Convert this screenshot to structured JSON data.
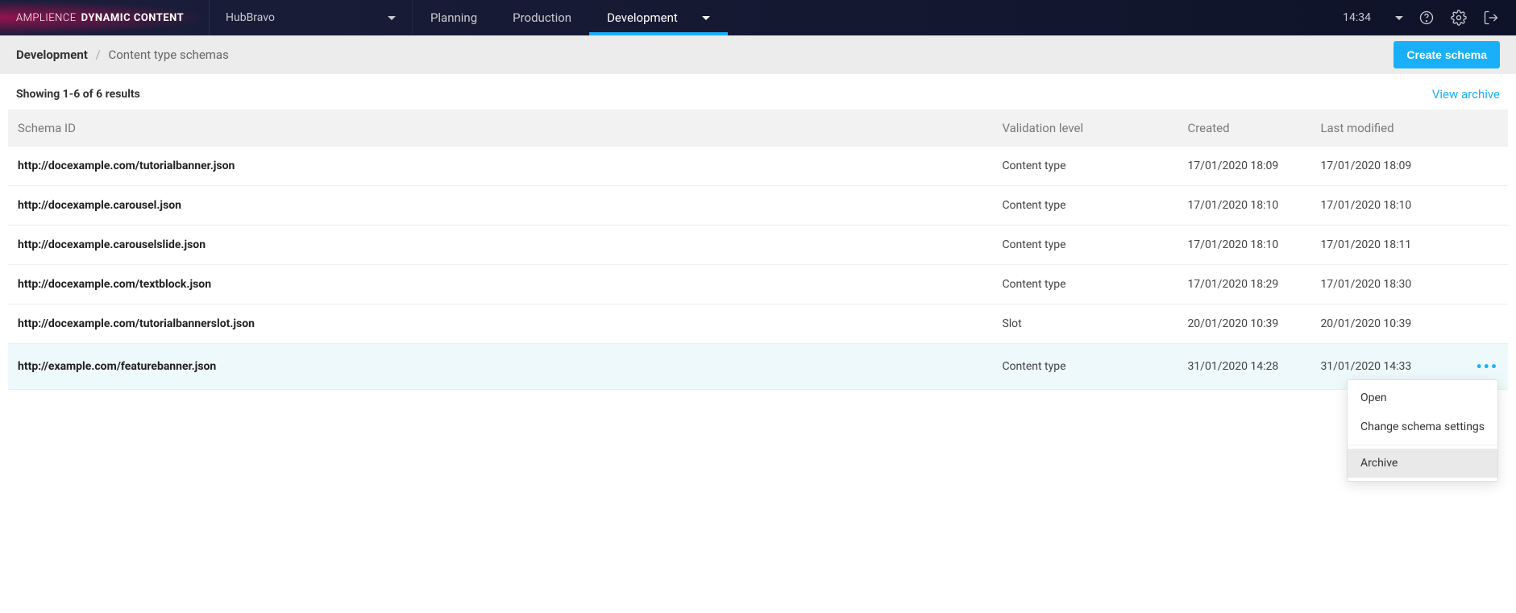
{
  "brand": {
    "light": "AMPLIENCE",
    "bold": "DYNAMIC CONTENT"
  },
  "hub": {
    "name": "HubBravo"
  },
  "nav": {
    "planning": "Planning",
    "production": "Production",
    "development": "Development"
  },
  "topbar": {
    "time": "14:34"
  },
  "breadcrumb": {
    "first": "Development",
    "second": "Content type schemas"
  },
  "actions": {
    "create_schema": "Create schema",
    "view_archive": "View archive"
  },
  "results_text": "Showing 1-6 of 6 results",
  "columns": {
    "schema_id": "Schema ID",
    "validation": "Validation level",
    "created": "Created",
    "modified": "Last modified"
  },
  "rows": [
    {
      "schema_id": "http://docexample.com/tutorialbanner.json",
      "validation": "Content type",
      "created": "17/01/2020 18:09",
      "modified": "17/01/2020 18:09"
    },
    {
      "schema_id": "http://docexample.carousel.json",
      "validation": "Content type",
      "created": "17/01/2020 18:10",
      "modified": "17/01/2020 18:10"
    },
    {
      "schema_id": "http://docexample.carouselslide.json",
      "validation": "Content type",
      "created": "17/01/2020 18:10",
      "modified": "17/01/2020 18:11"
    },
    {
      "schema_id": "http://docexample.com/textblock.json",
      "validation": "Content type",
      "created": "17/01/2020 18:29",
      "modified": "17/01/2020 18:30"
    },
    {
      "schema_id": "http://docexample.com/tutorialbannerslot.json",
      "validation": "Slot",
      "created": "20/01/2020 10:39",
      "modified": "20/01/2020 10:39"
    },
    {
      "schema_id": "http://example.com/featurebanner.json",
      "validation": "Content type",
      "created": "31/01/2020 14:28",
      "modified": "31/01/2020 14:33"
    }
  ],
  "context_menu": {
    "open": "Open",
    "change": "Change schema settings",
    "archive": "Archive"
  }
}
